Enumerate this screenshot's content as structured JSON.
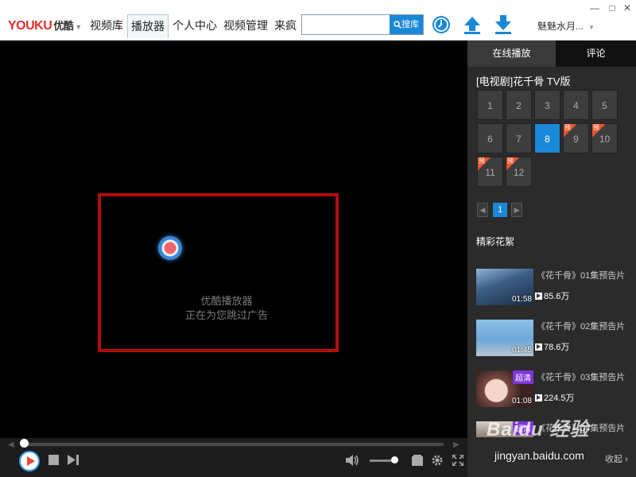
{
  "header": {
    "logo_text": "YOUKU",
    "logo_cn": "优酷",
    "nav": [
      {
        "label": "视频库",
        "active": false
      },
      {
        "label": "播放器",
        "active": true
      },
      {
        "label": "个人中心",
        "active": false
      },
      {
        "label": "视频管理",
        "active": false
      },
      {
        "label": "来疯",
        "active": false
      }
    ],
    "search": {
      "value": "",
      "placeholder": "",
      "button_label": "搜库"
    },
    "username": "魅魅水月...",
    "icons": [
      "clock-icon",
      "upload-icon",
      "download-icon"
    ],
    "window_controls": [
      "minimize-icon",
      "maximize-icon",
      "close-icon"
    ],
    "accent_color": "#1a88d8"
  },
  "player": {
    "message_line1": "优酷播放器",
    "message_line2": "正在为您跳过广告",
    "progress": 0.0,
    "volume": 0.9
  },
  "sidebar": {
    "tabs": [
      {
        "label": "在线播放",
        "active": true
      },
      {
        "label": "评论",
        "active": false
      }
    ],
    "series_title": "[电视剧]花千骨 TV版",
    "episodes": [
      {
        "num": "1",
        "preview": false,
        "active": false
      },
      {
        "num": "2",
        "preview": false,
        "active": false
      },
      {
        "num": "3",
        "preview": false,
        "active": false
      },
      {
        "num": "4",
        "preview": false,
        "active": false
      },
      {
        "num": "5",
        "preview": false,
        "active": false
      },
      {
        "num": "6",
        "preview": false,
        "active": false
      },
      {
        "num": "7",
        "preview": false,
        "active": false
      },
      {
        "num": "8",
        "preview": false,
        "active": true
      },
      {
        "num": "9",
        "preview": true,
        "active": false
      },
      {
        "num": "10",
        "preview": true,
        "active": false
      },
      {
        "num": "11",
        "preview": true,
        "active": false
      },
      {
        "num": "12",
        "preview": true,
        "active": false
      }
    ],
    "preview_badge": "预",
    "page": "1",
    "section_title": "精彩花絮",
    "clips": [
      {
        "title": "《花千骨》01集预告片",
        "duration": "01:58",
        "views": "85.6万",
        "hd": ""
      },
      {
        "title": "《花千骨》02集预告片",
        "duration": "01:45",
        "views": "78.6万",
        "hd": ""
      },
      {
        "title": "《花千骨》03集预告片",
        "duration": "01:08",
        "views": "224.5万",
        "hd": "超清"
      },
      {
        "title": "《花千骨》04集预告片",
        "duration": "",
        "views": "",
        "hd": "超清"
      }
    ],
    "collapse_label": "收起"
  },
  "watermark": {
    "brand": "Baidu 经验",
    "url": "jingyan.baidu.com"
  }
}
